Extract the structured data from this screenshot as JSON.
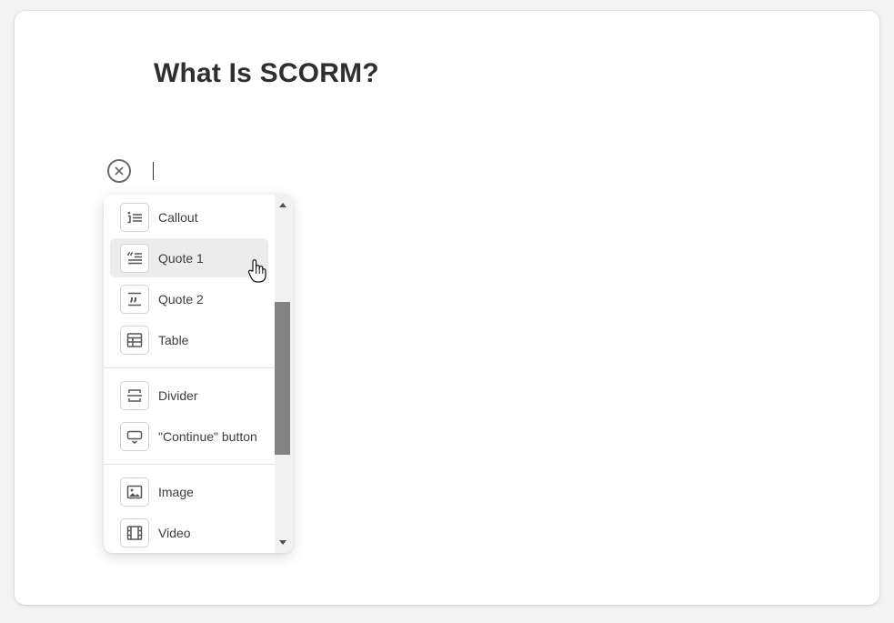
{
  "page": {
    "title": "What Is SCORM?"
  },
  "editor": {
    "close_icon": "circle-close-icon",
    "caret": "text-caret"
  },
  "block_menu": {
    "groups": [
      {
        "items": [
          {
            "label": "Callout",
            "icon": "callout-icon"
          },
          {
            "label": "Quote 1",
            "icon": "quote-1-icon",
            "hovered": true
          },
          {
            "label": "Quote 2",
            "icon": "quote-2-icon"
          },
          {
            "label": "Table",
            "icon": "table-icon"
          }
        ]
      },
      {
        "items": [
          {
            "label": "Divider",
            "icon": "divider-icon"
          },
          {
            "label": "\"Continue\" button",
            "icon": "continue-button-icon"
          }
        ]
      },
      {
        "items": [
          {
            "label": "Image",
            "icon": "image-icon"
          },
          {
            "label": "Video",
            "icon": "video-icon"
          }
        ]
      }
    ]
  },
  "colors": {
    "title": "#2f2f2f",
    "hover_bg": "#ececec",
    "icon_stroke": "#555555",
    "scroll_thumb": "#838383"
  }
}
